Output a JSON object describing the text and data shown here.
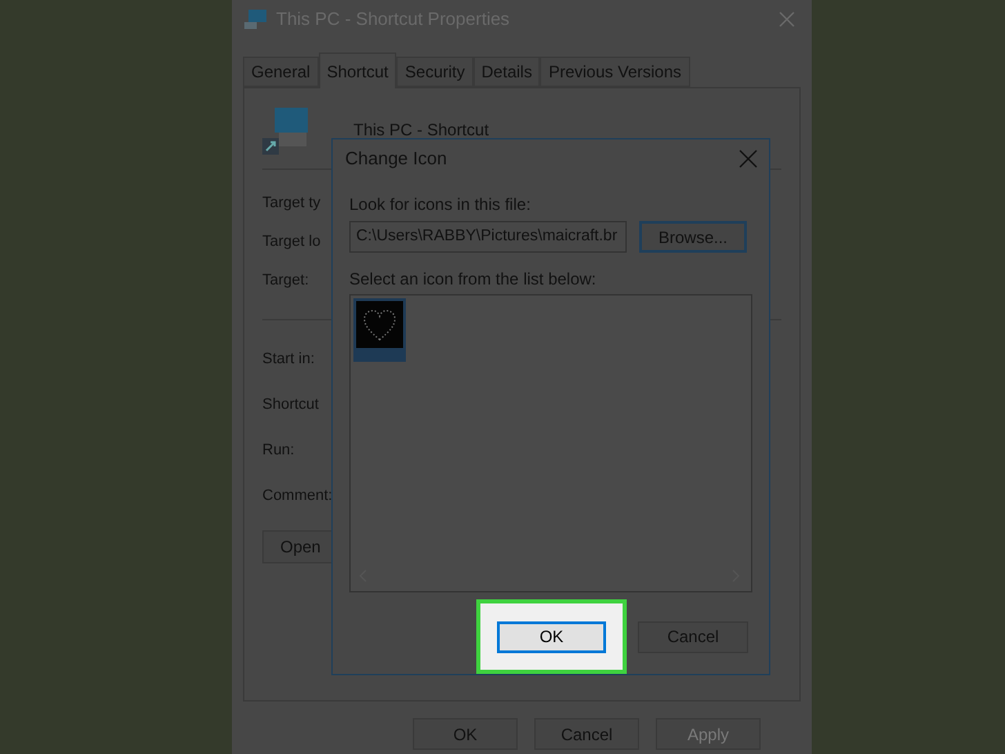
{
  "properties_window": {
    "title": "This PC - Shortcut Properties",
    "tabs": [
      {
        "label": "General",
        "selected": false
      },
      {
        "label": "Shortcut",
        "selected": true
      },
      {
        "label": "Security",
        "selected": false
      },
      {
        "label": "Details",
        "selected": false
      },
      {
        "label": "Previous Versions",
        "selected": false
      }
    ],
    "shortcut_name": "This PC - Shortcut",
    "field_groups": [
      [
        "Target ty",
        "Target lo",
        "Target:"
      ],
      [
        "Start in:",
        "Shortcut",
        "Run:",
        "Comment:"
      ]
    ],
    "open_button": "Open",
    "buttons": [
      {
        "label": "OK",
        "disabled": false
      },
      {
        "label": "Cancel",
        "disabled": false
      },
      {
        "label": "Apply",
        "disabled": true
      }
    ]
  },
  "change_icon_dialog": {
    "title": "Change Icon",
    "file_label": "Look for icons in this file:",
    "file_path": "C:\\Users\\RABBY\\Pictures\\maicraft.br",
    "browse_button": "Browse...",
    "list_label": "Select an icon from the list below:",
    "icons": [
      {
        "selected": true
      }
    ],
    "buttons": [
      {
        "label": "OK",
        "highlighted": true
      },
      {
        "label": "Cancel",
        "highlighted": false
      }
    ]
  }
}
